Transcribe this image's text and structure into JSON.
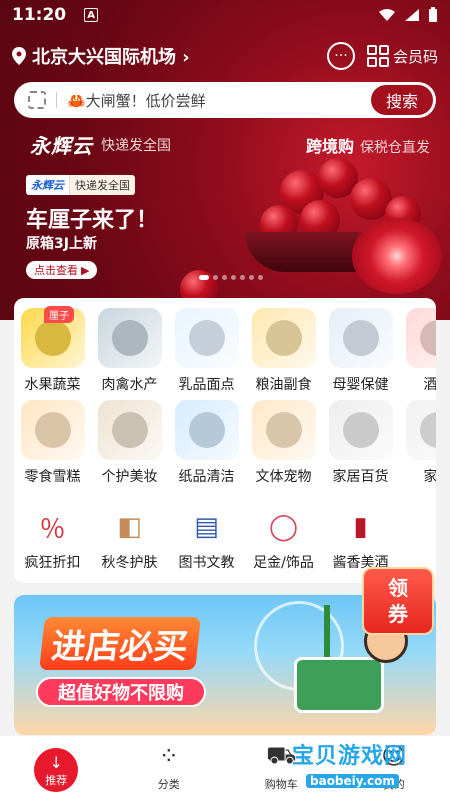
{
  "status_bar": {
    "time": "11:20",
    "a_icon": "A"
  },
  "location": {
    "name": "北京大兴国际机场",
    "arrow": "›"
  },
  "header": {
    "member_label": "会员码",
    "message_icon": "chat-bubble-icon"
  },
  "search": {
    "placeholder": "🦀大闸蟹！低价尝鲜",
    "button": "搜索"
  },
  "brand": {
    "logo": "永辉云",
    "subtitle": "快递发全国",
    "cross_title": "跨境购",
    "cross_sub": "保税仓直发"
  },
  "banner": {
    "tag_logo": "永辉云",
    "tag_text": "快递发全国",
    "title": "车厘子来了！",
    "subtitle": "原箱3J上新",
    "button": "点击查看",
    "dots_total": 7,
    "dots_active": 0
  },
  "categories": [
    {
      "label": "水果蔬菜",
      "badge": "厘子",
      "icon": "fruit-icon",
      "color": "#ffd84a"
    },
    {
      "label": "肉禽水产",
      "icon": "fish-icon",
      "color": "#c9d6de"
    },
    {
      "label": "乳品面点",
      "icon": "milk-icon",
      "color": "#e9f3ff"
    },
    {
      "label": "粮油副食",
      "icon": "oil-icon",
      "color": "#ffe7b0"
    },
    {
      "label": "母婴保健",
      "icon": "baby-formula-icon",
      "color": "#e6eef9"
    },
    {
      "label": "酒水",
      "icon": "drink-icon",
      "color": "#ffd9d9"
    },
    {
      "label": "零食雪糕",
      "icon": "ice-cream-icon",
      "color": "#ffe6c4"
    },
    {
      "label": "个护美妆",
      "icon": "cosmetics-icon",
      "color": "#efe3d2"
    },
    {
      "label": "纸品清洁",
      "icon": "tissue-icon",
      "color": "#d6ecff"
    },
    {
      "label": "文体宠物",
      "icon": "pet-icon",
      "color": "#ffe8c8"
    },
    {
      "label": "家居百货",
      "icon": "luggage-icon",
      "color": "#eeeeee"
    },
    {
      "label": "家电",
      "icon": "appliance-icon",
      "color": "#f1f1f1"
    }
  ],
  "small_categories": [
    {
      "label": "疯狂折扣",
      "icon": "discount-icon"
    },
    {
      "label": "秋冬护肤",
      "icon": "skincare-icon"
    },
    {
      "label": "图书文教",
      "icon": "book-icon"
    },
    {
      "label": "足金/饰品",
      "icon": "necklace-icon"
    },
    {
      "label": "酱香美酒",
      "icon": "liquor-icon"
    }
  ],
  "store_banner": {
    "title": "进店必买",
    "subtitle": "超值好物不限购"
  },
  "coupon": {
    "line1": "领",
    "line2": "券"
  },
  "bottom_nav": [
    {
      "label": "推荐",
      "icon": "arrow-down-icon",
      "active": true
    },
    {
      "label": "分类",
      "icon": "grid-icon"
    },
    {
      "label": "购物车",
      "icon": "cart-icon"
    },
    {
      "label": "我的",
      "icon": "profile-icon"
    }
  ],
  "watermark": {
    "title": "宝贝游戏网",
    "url": "baobeiy.com"
  }
}
